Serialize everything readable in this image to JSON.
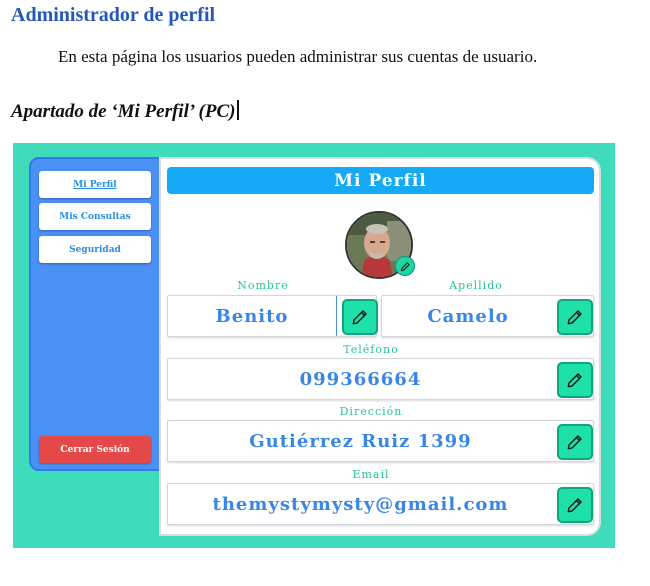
{
  "document": {
    "title": "Administrador de perfil",
    "paragraph": "En esta página los usuarios pueden administrar sus cuentas de usuario.",
    "subtitle": "Apartado de ‘Mi Perfil’ (PC)"
  },
  "sidebar": {
    "items": [
      {
        "label": "Mi Perfil"
      },
      {
        "label": "Mis Consultas"
      },
      {
        "label": "Seguridad"
      }
    ],
    "logout_label": "Cerrar Sesión"
  },
  "profile": {
    "header": "Mi Perfil",
    "fields": {
      "nombre": {
        "label": "Nombre",
        "value": "Benito"
      },
      "apellido": {
        "label": "Apellido",
        "value": "Camelo"
      },
      "telefono": {
        "label": "Teléfono",
        "value": "099366664"
      },
      "direccion": {
        "label": "Dirección",
        "value": "Gutiérrez Ruiz 1399"
      },
      "email": {
        "label": "Email",
        "value": "themystymysty@gmail.com"
      }
    }
  },
  "colors": {
    "background_teal": "#3fdcbc",
    "sidebar_blue": "#4a90f5",
    "header_blue": "#16a9f5",
    "edit_green": "#1fe0a8",
    "logout_red": "#e54848",
    "value_blue": "#3a86e6"
  },
  "icons": {
    "edit": "pencil-icon"
  }
}
